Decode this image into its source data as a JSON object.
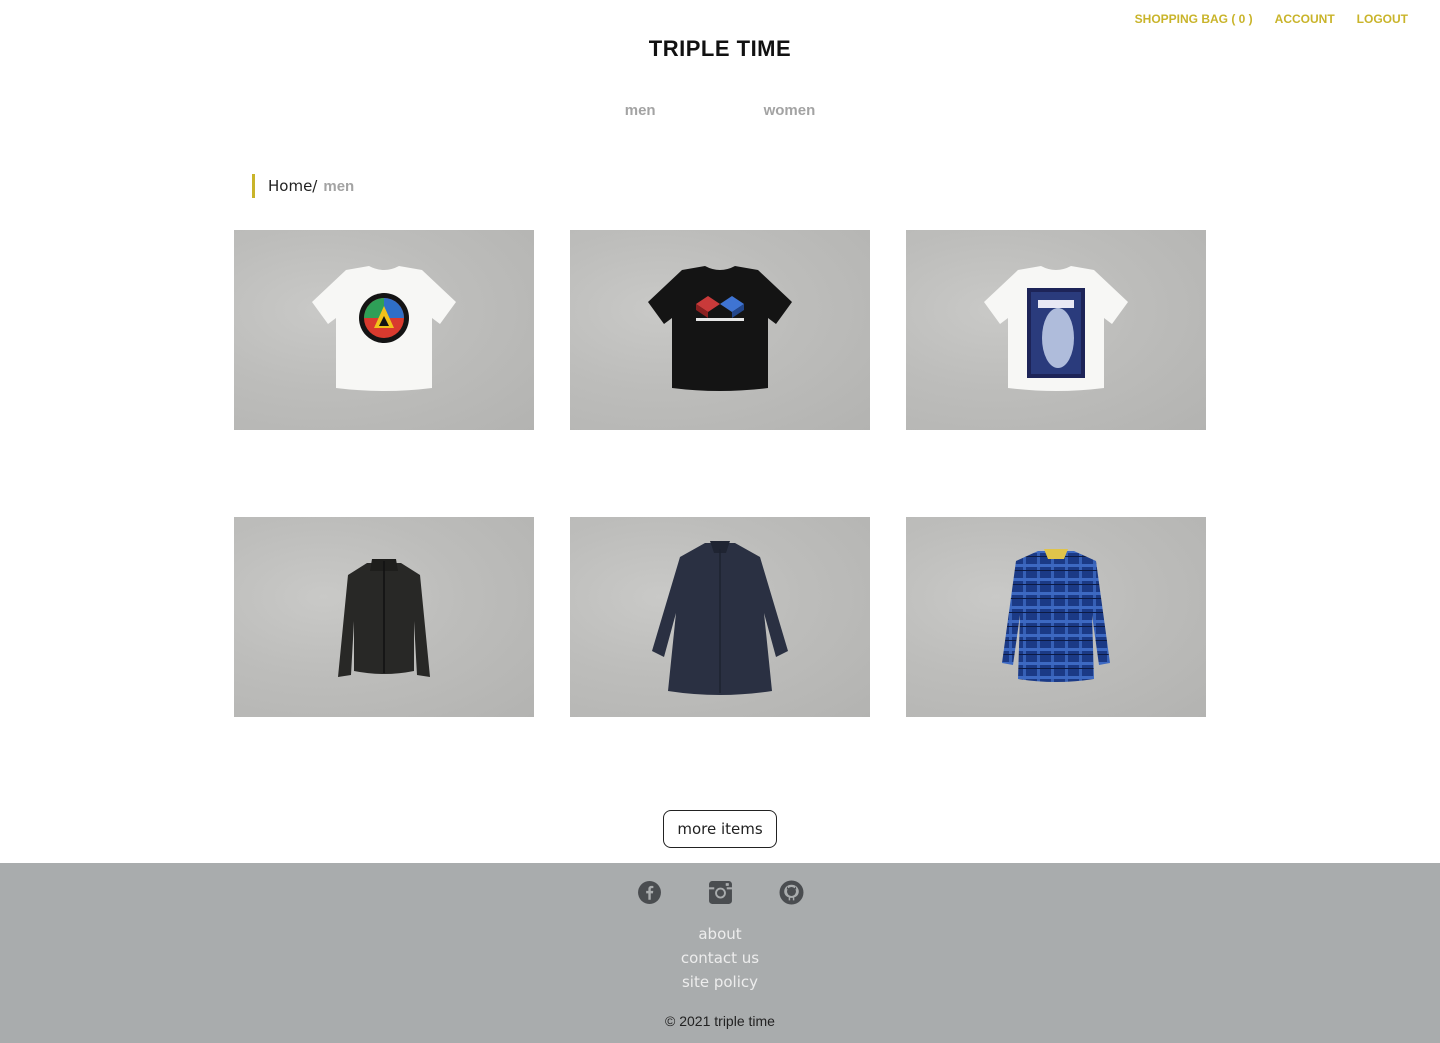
{
  "header": {
    "shopping_bag": "SHOPPING BAG ( 0 )",
    "account": "ACCOUNT",
    "logout": "LOGOUT",
    "brand": "TRIPLE TIME"
  },
  "nav": {
    "men": "men",
    "women": "women"
  },
  "breadcrumb": {
    "home": "Home",
    "separator": "/",
    "current": "men"
  },
  "products": [
    {
      "image": "white-tshirt-mountain-logo"
    },
    {
      "image": "black-tshirt-blocks-print"
    },
    {
      "image": "white-tshirt-fantasia-print"
    },
    {
      "image": "black-fleece-jacket"
    },
    {
      "image": "navy-long-coat"
    },
    {
      "image": "blue-plaid-shirt"
    }
  ],
  "more_button": "more items",
  "footer": {
    "icons": [
      "facebook-icon",
      "instagram-icon",
      "github-icon"
    ],
    "about": "about",
    "contact": "contact us",
    "policy": "site policy",
    "copyright": "© 2021 triple time"
  },
  "colors": {
    "accent": "#c9b42a",
    "nav_text": "#a3a3a3",
    "footer_bg": "#a9acad"
  }
}
